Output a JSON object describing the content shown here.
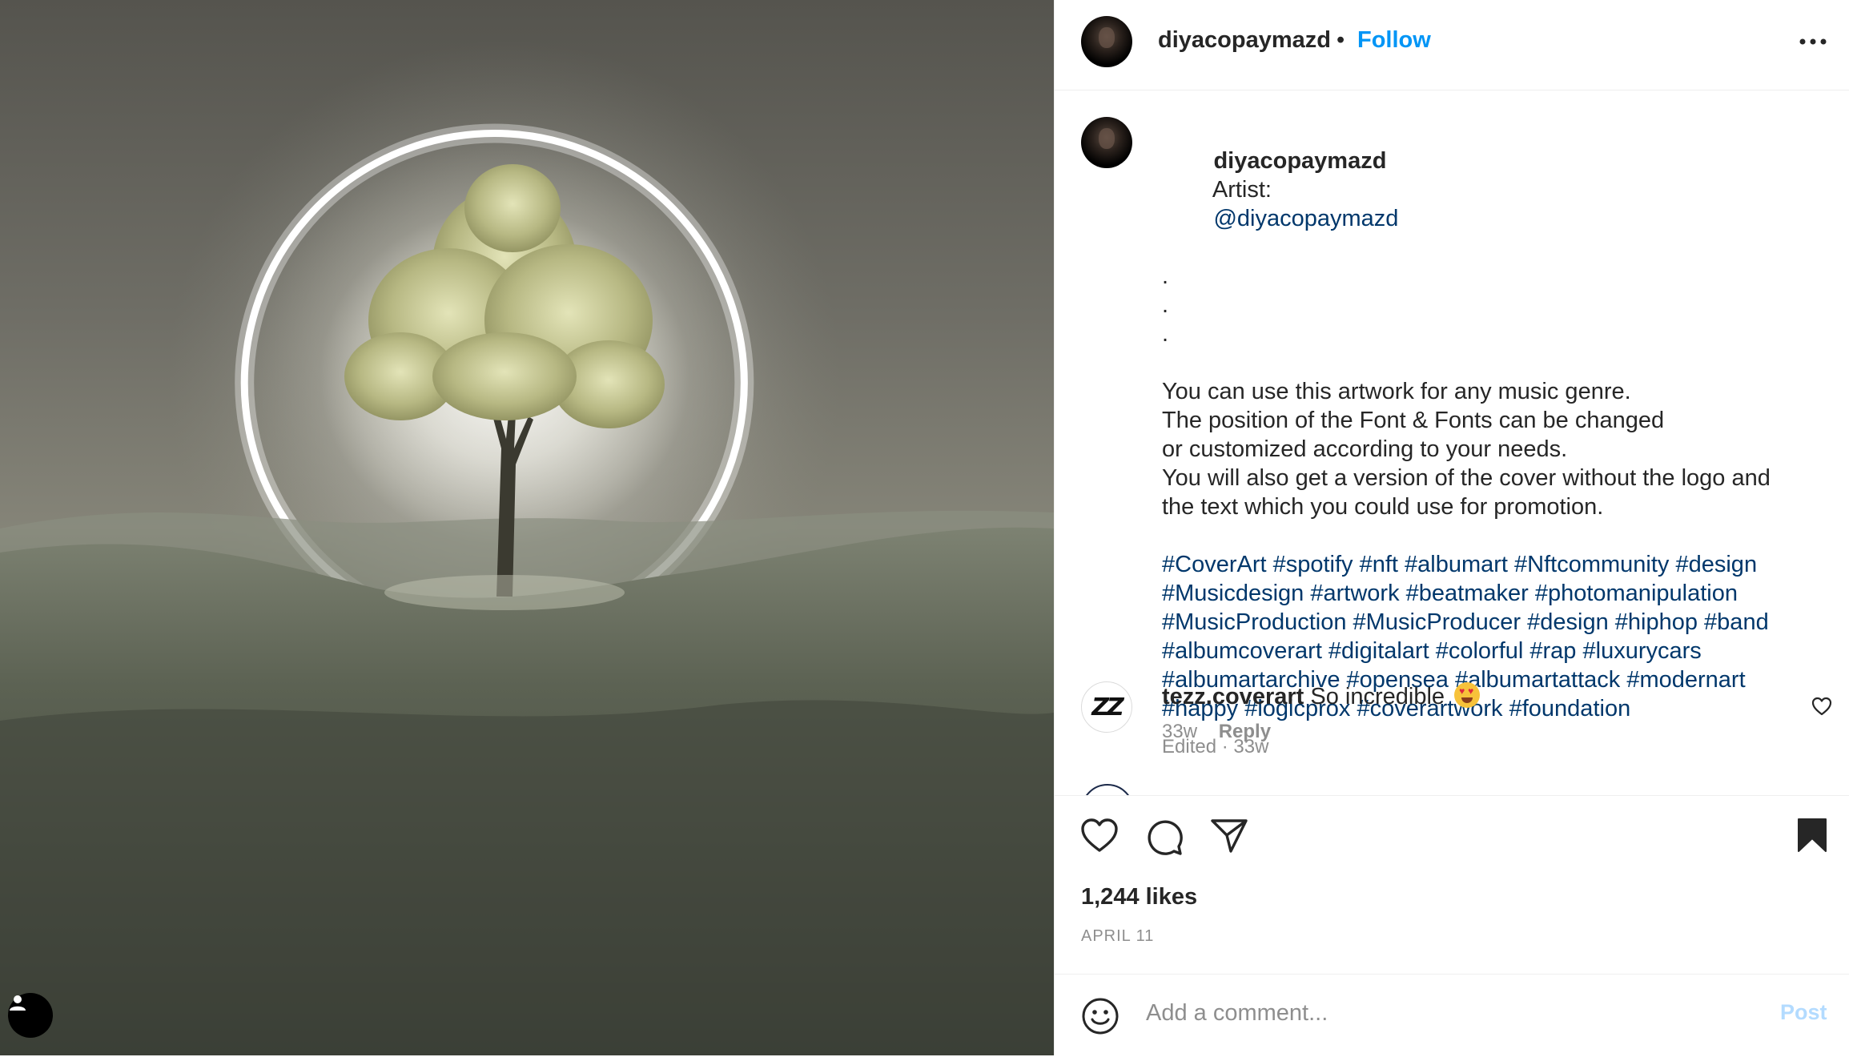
{
  "post": {
    "username": "diyacopaymazd",
    "separator": "•",
    "follow_label": "Follow",
    "more_icon": "more-horizontal-icon"
  },
  "caption": {
    "username": "diyacopaymazd",
    "artist_label": "Artist:",
    "artist_mention": "@diyacopaymazd",
    "dots": [
      ".",
      ".",
      "."
    ],
    "body_lines": [
      "You can use this artwork for any music genre.",
      "The position of the Font & Fonts can be changed",
      "or customized according to your needs.",
      "You will also get a version of the cover without the logo and",
      "the text which you could use for promotion."
    ],
    "hashtag_lines": [
      "#CoverArt #spotify #nft #albumart #Nftcommunity #design",
      "#Musicdesign #artwork #beatmaker #photomanipulation",
      "#MusicProduction #MusicProducer #design #hiphop #band",
      "#albumcoverart #digitalart #colorful #rap #luxurycars",
      "#albumartarchive #opensea #albumartattack #modernart",
      "#happy #logicprox #coverartwork #foundation"
    ],
    "meta": "Edited · 33w"
  },
  "comment": {
    "avatar_text": "ZZ",
    "username": "tezz.coverart",
    "text": "So incredible",
    "time": "33w",
    "reply_label": "Reply"
  },
  "actions": {
    "likes": "1,244 likes",
    "date": "April 11"
  },
  "add_comment": {
    "placeholder": "Add a comment...",
    "post_label": "Post"
  },
  "colors": {
    "link": "#0095f6",
    "hashtag": "#00376b",
    "muted": "#8e8e8e",
    "post_disabled": "#b3dbff"
  }
}
